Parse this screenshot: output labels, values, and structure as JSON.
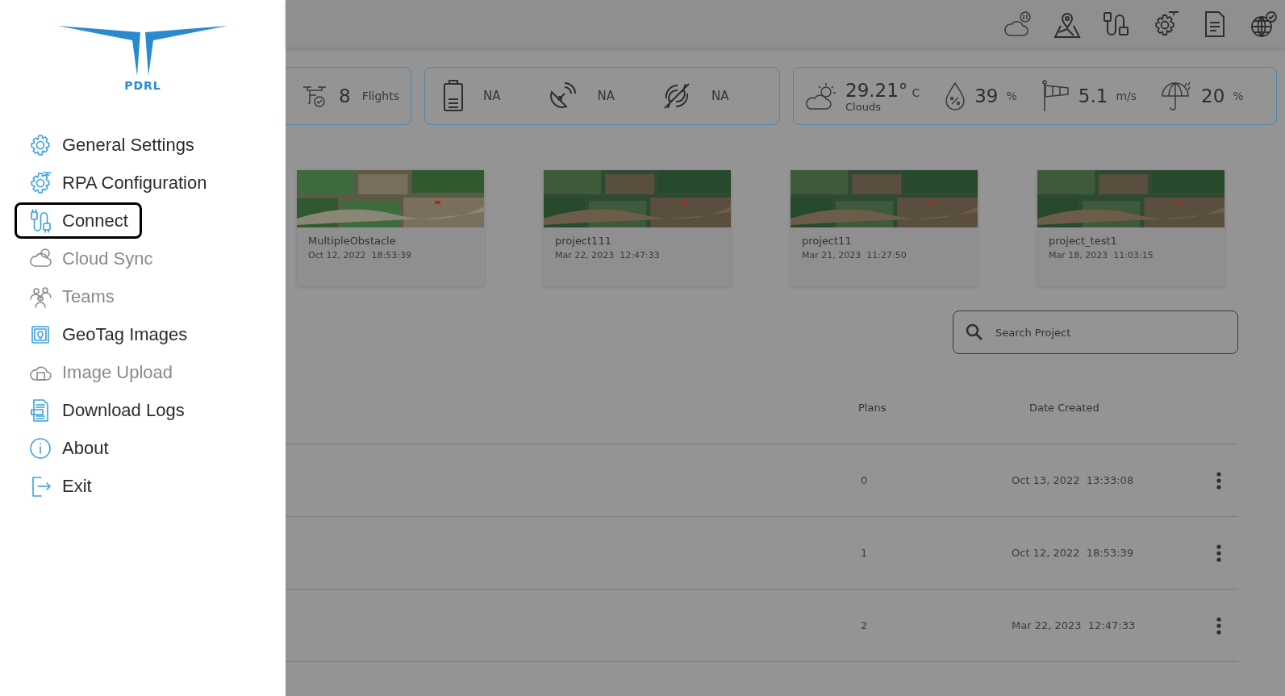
{
  "logo": {
    "text": "PDRL"
  },
  "sidebar": {
    "items": [
      {
        "label": "General Settings",
        "disabled": false,
        "selected": false
      },
      {
        "label": "RPA Configuration",
        "disabled": false,
        "selected": false
      },
      {
        "label": "Connect",
        "disabled": false,
        "selected": true
      },
      {
        "label": "Cloud Sync",
        "disabled": true,
        "selected": false
      },
      {
        "label": "Teams",
        "disabled": true,
        "selected": false
      },
      {
        "label": "GeoTag Images",
        "disabled": false,
        "selected": false
      },
      {
        "label": "Image Upload",
        "disabled": true,
        "selected": false
      },
      {
        "label": "Download Logs",
        "disabled": false,
        "selected": false
      },
      {
        "label": "About",
        "disabled": false,
        "selected": false
      },
      {
        "label": "Exit",
        "disabled": false,
        "selected": false
      }
    ]
  },
  "stats": {
    "flights": {
      "count": "8",
      "unit": "Flights"
    },
    "battery": "NA",
    "signal": "NA",
    "propeller": "NA"
  },
  "weather": {
    "temperature": "29.21°",
    "temp_unit": "C",
    "condition": "Clouds",
    "humidity": "39",
    "humidity_unit": "%",
    "wind": "5.1",
    "wind_unit": "m/s",
    "rain": "20",
    "rain_unit": "%"
  },
  "projects": [
    {
      "name": "MultipleObstacle",
      "date": "Oct 12, 2022",
      "time": "18:53:39"
    },
    {
      "name": "project111",
      "date": "Mar 22, 2023",
      "time": "12:47:33"
    },
    {
      "name": "project11",
      "date": "Mar 21, 2023",
      "time": "11:27:50"
    },
    {
      "name": "project_test1",
      "date": "Mar 18, 2023",
      "time": "11:03:15"
    }
  ],
  "search": {
    "placeholder": "Search Project"
  },
  "table": {
    "columns": [
      "Plans",
      "Date Created"
    ],
    "rows": [
      {
        "plans": "0",
        "date": "Oct 13, 2022",
        "time": "13:33:08"
      },
      {
        "plans": "1",
        "date": "Oct 12, 2022",
        "time": "18:53:39"
      },
      {
        "plans": "2",
        "date": "Mar 22, 2023",
        "time": "12:47:33"
      }
    ]
  }
}
